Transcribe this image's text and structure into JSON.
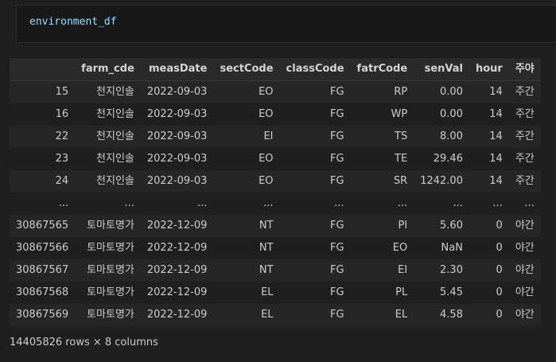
{
  "code_cell": {
    "source": "environment_df"
  },
  "dataframe": {
    "columns": [
      "",
      "farm_cde",
      "measDate",
      "sectCode",
      "classCode",
      "fatrCode",
      "senVal",
      "hour",
      "주야"
    ],
    "rows": [
      [
        "15",
        "천지인솔",
        "2022-09-03",
        "EO",
        "FG",
        "RP",
        "0.00",
        "14",
        "주간"
      ],
      [
        "16",
        "천지인솔",
        "2022-09-03",
        "EO",
        "FG",
        "WP",
        "0.00",
        "14",
        "주간"
      ],
      [
        "22",
        "천지인솔",
        "2022-09-03",
        "EI",
        "FG",
        "TS",
        "8.00",
        "14",
        "주간"
      ],
      [
        "23",
        "천지인솔",
        "2022-09-03",
        "EO",
        "FG",
        "TE",
        "29.46",
        "14",
        "주간"
      ],
      [
        "24",
        "천지인솔",
        "2022-09-03",
        "EO",
        "FG",
        "SR",
        "1242.00",
        "14",
        "주간"
      ],
      [
        "...",
        "...",
        "...",
        "...",
        "...",
        "...",
        "...",
        "...",
        "..."
      ],
      [
        "30867565",
        "토마토명가",
        "2022-12-09",
        "NT",
        "FG",
        "PI",
        "5.60",
        "0",
        "야간"
      ],
      [
        "30867566",
        "토마토명가",
        "2022-12-09",
        "NT",
        "FG",
        "EO",
        "NaN",
        "0",
        "야간"
      ],
      [
        "30867567",
        "토마토명가",
        "2022-12-09",
        "NT",
        "FG",
        "EI",
        "2.30",
        "0",
        "야간"
      ],
      [
        "30867568",
        "토마토명가",
        "2022-12-09",
        "EL",
        "FG",
        "PL",
        "5.45",
        "0",
        "야간"
      ],
      [
        "30867569",
        "토마토명가",
        "2022-12-09",
        "EL",
        "FG",
        "EL",
        "4.58",
        "0",
        "야간"
      ]
    ],
    "shape_text": "14405826 rows × 8 columns"
  }
}
